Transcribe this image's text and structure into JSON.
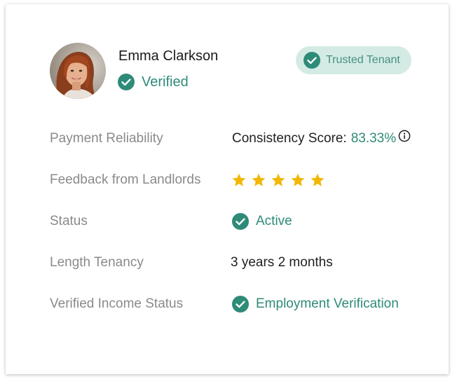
{
  "profile": {
    "name": "Emma Clarkson",
    "verified_label": "Verified"
  },
  "badge": {
    "label": "Trusted Tenant"
  },
  "rows": {
    "payment": {
      "label": "Payment Reliability",
      "score_label": "Consistency Score:",
      "score_value": "83.33%"
    },
    "feedback": {
      "label": "Feedback from Landlords",
      "rating": 5,
      "max_rating": 5
    },
    "status": {
      "label": "Status",
      "value": "Active"
    },
    "tenancy": {
      "label": "Length Tenancy",
      "value": "3 years 2 months"
    },
    "income": {
      "label": "Verified Income Status",
      "value": "Employment Verification"
    }
  },
  "icons": {
    "verified": "check-circle-icon",
    "info": "info-icon",
    "star": "star-icon"
  },
  "colors": {
    "accent_green": "#2e8b78",
    "badge_bg": "#d4ebe5",
    "star_gold": "#f2b705",
    "label_gray": "#8a8a8a"
  }
}
